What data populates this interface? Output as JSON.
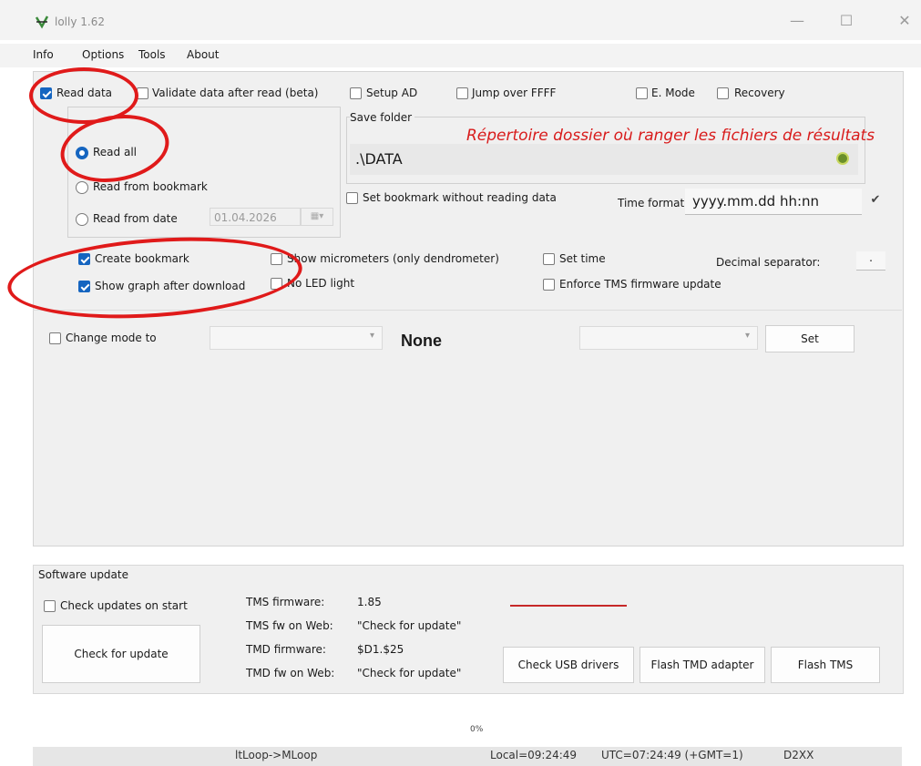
{
  "window": {
    "title": "lolly 1.62",
    "minimize": "—",
    "maximize": "☐",
    "close": "✕"
  },
  "menu": [
    "Info",
    "Options",
    "Tools",
    "About"
  ],
  "top_options": {
    "read_data": "Read data",
    "validate": "Validate data after read (beta)",
    "setup_ad": "Setup AD",
    "jump_ffff": "Jump over FFFF",
    "e_mode": "E. Mode",
    "recovery": "Recovery"
  },
  "read_mode": {
    "read_all": "Read all",
    "read_bookmark": "Read from bookmark",
    "read_date": "Read from date",
    "date_value": "01.04.2026"
  },
  "save": {
    "folder_label": "Save folder",
    "path": ".\\DATA",
    "set_bookmark": "Set bookmark without reading data",
    "time_format_label": "Time format",
    "time_format": "yyyy.mm.dd hh:nn"
  },
  "annotation_text": "Répertoire dossier où ranger les fichiers de résultats",
  "options2": {
    "create_bookmark": "Create bookmark",
    "show_graph": "Show graph after download",
    "show_micrometers": "Show micrometers (only dendrometer)",
    "no_led": "No LED light",
    "set_time": "Set time",
    "enforce_tms": "Enforce TMS firmware update",
    "decimal_sep_label": "Decimal separator:",
    "decimal_sep_value": "."
  },
  "mode": {
    "change_mode": "Change mode to",
    "current": "None",
    "set_button": "Set"
  },
  "software_update": {
    "title": "Software update",
    "check_on_start": "Check updates on start",
    "check_button": "Check for update",
    "tms_fw_label": "TMS firmware:",
    "tms_fw_value": "1.85",
    "tms_web_label": "TMS fw on Web:",
    "tms_web_value": "\"Check for update\"",
    "tmd_fw_label": "TMD firmware:",
    "tmd_fw_value": "$D1.$25",
    "tmd_web_label": "TMD fw on Web:",
    "tmd_web_value": "\"Check for update\"",
    "usb_button": "Check USB drivers",
    "flash_tmd_button": "Flash TMD adapter",
    "flash_tms_button": "Flash TMS"
  },
  "progress": {
    "text": "0%",
    "value": 0
  },
  "status": {
    "loop": "ltLoop->MLoop",
    "local": "Local=09:24:49",
    "utc": "UTC=07:24:49 (+GMT=1)",
    "driver": "D2XX"
  },
  "colors": {
    "accent": "#1565c0",
    "annotation": "#e01a1a"
  }
}
